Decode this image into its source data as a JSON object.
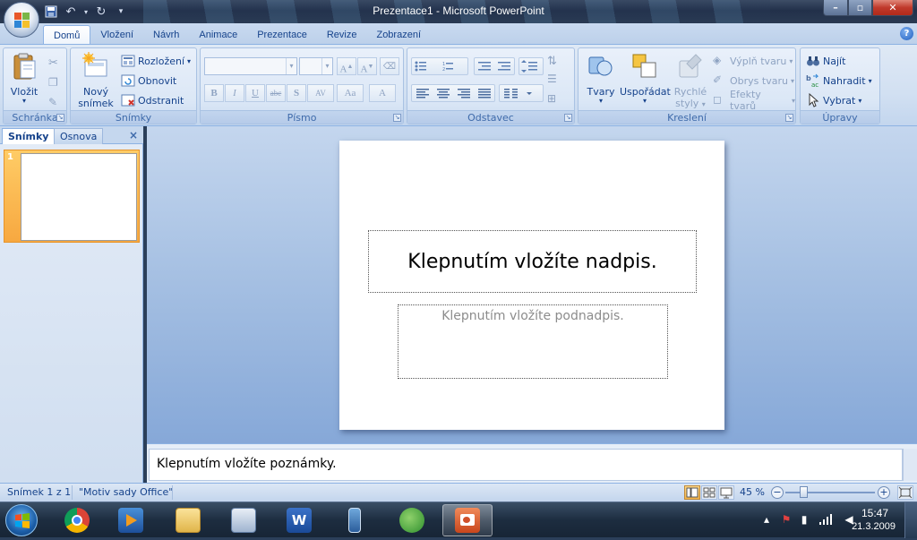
{
  "window": {
    "title": "Prezentace1 - Microsoft PowerPoint",
    "controls": {
      "minimize": "–",
      "maximize": "▫",
      "close": "✕"
    }
  },
  "quick_access": {
    "icons": [
      "save-icon",
      "undo-icon",
      "redo-icon",
      "customize-icon"
    ]
  },
  "ribbon": {
    "tabs": [
      "Domů",
      "Vložení",
      "Návrh",
      "Animace",
      "Prezentace",
      "Revize",
      "Zobrazení"
    ],
    "active_tab": "Domů",
    "groups": {
      "clipboard": {
        "label": "Schránka",
        "paste": "Vložit"
      },
      "slides": {
        "label": "Snímky",
        "new_slide_line1": "Nový",
        "new_slide_line2": "snímek",
        "layout": "Rozložení",
        "reset": "Obnovit",
        "delete": "Odstranit"
      },
      "font": {
        "label": "Písmo",
        "buttons": [
          "B",
          "I",
          "U",
          "abc",
          "S",
          "AV",
          "Aa",
          "A"
        ]
      },
      "paragraph": {
        "label": "Odstavec"
      },
      "drawing": {
        "label": "Kreslení",
        "shapes": "Tvary",
        "arrange": "Uspořádat",
        "quick_styles_line1": "Rychlé",
        "quick_styles_line2": "styly",
        "shape_fill": "Výplň tvaru",
        "shape_outline": "Obrys tvaru",
        "shape_effects": "Efekty tvarů"
      },
      "editing": {
        "label": "Úpravy",
        "find": "Najít",
        "replace": "Nahradit",
        "select": "Vybrat"
      }
    }
  },
  "left_pane": {
    "tabs": [
      "Snímky",
      "Osnova"
    ],
    "close": "×",
    "slide_number": "1"
  },
  "slide": {
    "title_placeholder": "Klepnutím vložíte nadpis.",
    "subtitle_placeholder": "Klepnutím vložíte podnadpis."
  },
  "notes": {
    "placeholder": "Klepnutím vložíte poznámky."
  },
  "status_bar": {
    "slide_info": "Snímek 1 z 1",
    "theme": "\"Motiv sady Office\"",
    "zoom": "45 %",
    "zoom_out": "−",
    "zoom_in": "+"
  },
  "taskbar": {
    "time": "15:47",
    "date": "21.3.2009",
    "apps": [
      "chrome-icon",
      "media-player-icon",
      "explorer-icon",
      "task-app-icon",
      "word-icon",
      "usb-icon",
      "messenger-icon",
      "powerpoint-icon"
    ],
    "active_app": "powerpoint-icon"
  }
}
